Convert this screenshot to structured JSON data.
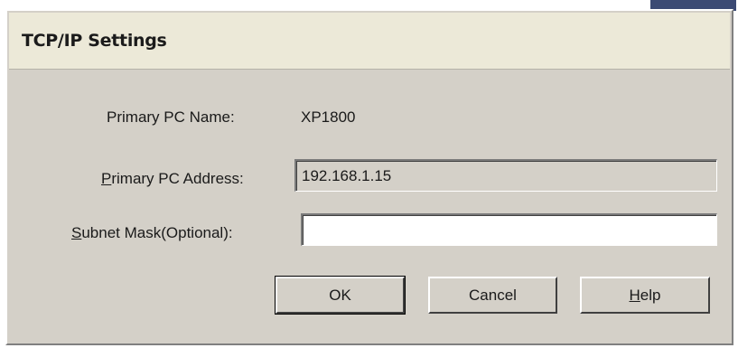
{
  "dialog": {
    "title": "TCP/IP Settings"
  },
  "fields": {
    "primary_pc_name": {
      "label": "Primary PC Name:",
      "value": "XP1800"
    },
    "primary_pc_address": {
      "label_accel": "P",
      "label_rest": "rimary PC Address:",
      "value": "192.168.1.15"
    },
    "subnet_mask": {
      "label_accel": "S",
      "label_rest": "ubnet Mask(Optional):",
      "value": ""
    }
  },
  "buttons": {
    "ok_label": "OK",
    "cancel_label": "Cancel",
    "help_accel": "H",
    "help_rest": "elp"
  }
}
